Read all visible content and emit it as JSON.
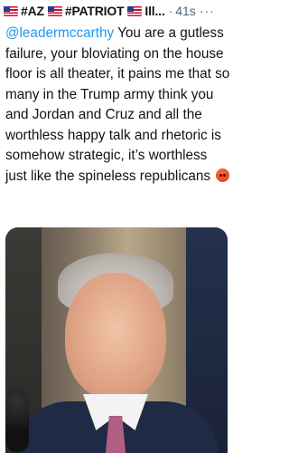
{
  "header": {
    "display_name": "#AZ",
    "tag2": "#PATRIOT",
    "tag3": "Ill...",
    "separator": "·",
    "time": "41s",
    "more": "···"
  },
  "tweet": {
    "mention": "@leadermccarthy",
    "body": " You are a gutless failure, your bloviating on the house floor is all theater, it pains me that so many in the Trump army think you and Jordan and Cruz and all the worthless happy talk and rhetoric is somehow strategic, it’s worthless just like the spineless republicans ",
    "emoji_icon": "angry-face-emoji"
  },
  "colors": {
    "mention": "#1d9bf0",
    "text": "#0f1419",
    "muted": "#536471"
  }
}
